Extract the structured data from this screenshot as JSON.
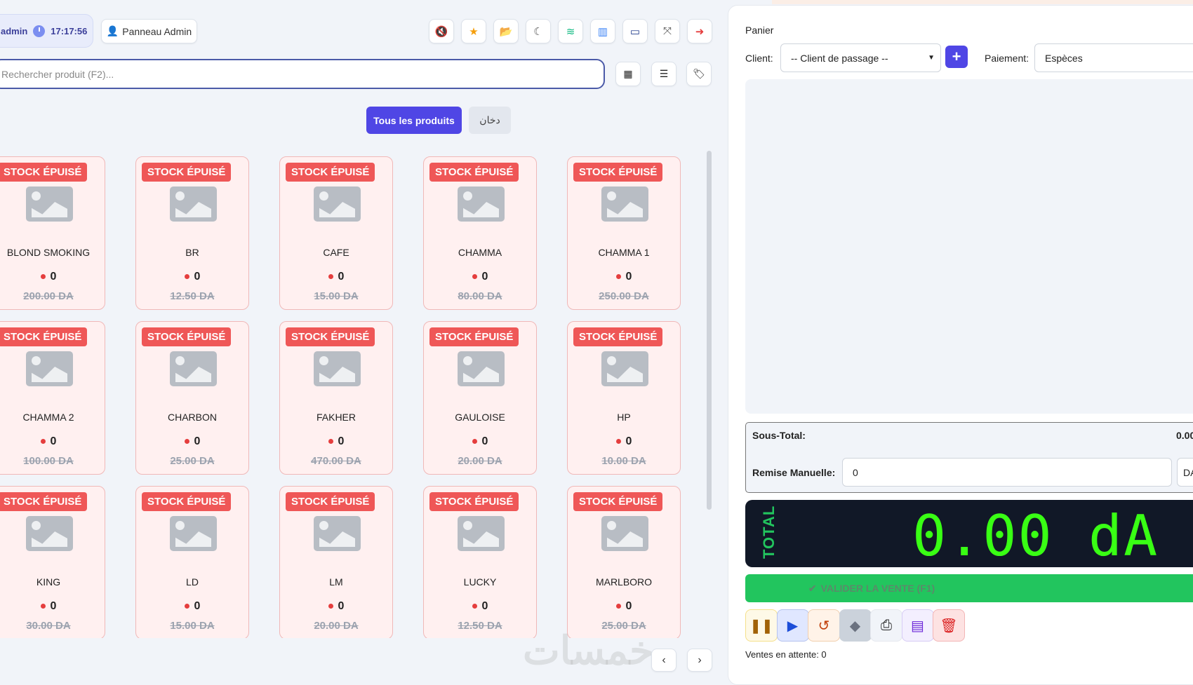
{
  "header": {
    "user": "admin",
    "time": "17:17:56",
    "admin_panel": "Panneau Admin",
    "toolbar": [
      {
        "icon": "mute-icon",
        "color": "#e53e3e"
      },
      {
        "icon": "star-icon",
        "color": "#f59e0b"
      },
      {
        "icon": "folder-icon",
        "color": "#4f46e5"
      },
      {
        "icon": "moon-icon",
        "color": "#555"
      },
      {
        "icon": "database-icon",
        "color": "#10b981"
      },
      {
        "icon": "chart-icon",
        "color": "#3b82f6"
      },
      {
        "icon": "monitor-icon",
        "color": "#1e3a8a"
      },
      {
        "icon": "expand-icon",
        "color": "#555"
      },
      {
        "icon": "logout-icon",
        "color": "#e53e3e"
      }
    ]
  },
  "search": {
    "placeholder": "Rechercher produit (F2)..."
  },
  "categories": [
    "Tous les produits",
    "دخان"
  ],
  "badge": "STOCK ÉPUISÉ",
  "products": [
    {
      "name": "BLOND SMOKING",
      "stock": "0",
      "price": "200.00 DA"
    },
    {
      "name": "BR",
      "stock": "0",
      "price": "12.50 DA"
    },
    {
      "name": "CAFE",
      "stock": "0",
      "price": "15.00 DA"
    },
    {
      "name": "CHAMMA",
      "stock": "0",
      "price": "80.00 DA"
    },
    {
      "name": "CHAMMA 1",
      "stock": "0",
      "price": "250.00 DA"
    },
    {
      "name": "CHAMMA 2",
      "stock": "0",
      "price": "100.00 DA"
    },
    {
      "name": "CHARBON",
      "stock": "0",
      "price": "25.00 DA"
    },
    {
      "name": "FAKHER",
      "stock": "0",
      "price": "470.00 DA"
    },
    {
      "name": "GAULOISE",
      "stock": "0",
      "price": "20.00 DA"
    },
    {
      "name": "HP",
      "stock": "0",
      "price": "10.00 DA"
    },
    {
      "name": "KING",
      "stock": "0",
      "price": "30.00 DA"
    },
    {
      "name": "LD",
      "stock": "0",
      "price": "15.00 DA"
    },
    {
      "name": "LM",
      "stock": "0",
      "price": "20.00 DA"
    },
    {
      "name": "LUCKY",
      "stock": "0",
      "price": "12.50 DA"
    },
    {
      "name": "MARLBORO",
      "stock": "0",
      "price": "25.00 DA"
    }
  ],
  "watermark": "خمسات",
  "cart": {
    "title": "Panier",
    "client_label": "Client:",
    "client_value": "-- Client de passage --",
    "payment_label": "Paiement:",
    "payment_value": "Espèces",
    "subtotal_label": "Sous-Total:",
    "subtotal_value": "0.00",
    "discount_label": "Remise Manuelle:",
    "discount_value": "0",
    "discount_unit": "DA",
    "total_label": "TOTAL",
    "total_value": "0.00 dA",
    "validate": "VALIDER LA VENTE (F1)",
    "pending": "Ventes en attente: 0"
  },
  "actions": [
    {
      "icon": "pause-icon",
      "glyph": "❚❚",
      "color": "#a16207",
      "bg": "#fef9e7",
      "border": "#f5e08a"
    },
    {
      "icon": "play-icon",
      "glyph": "▶",
      "color": "#1d4ed8",
      "bg": "#e0e7ff",
      "border": "#b5c3ee"
    },
    {
      "icon": "undo-icon",
      "glyph": "↺",
      "color": "#c2410c",
      "bg": "#fff3e8",
      "border": "#f1cfae"
    },
    {
      "icon": "diamond-icon",
      "glyph": "◆",
      "color": "#6b7280",
      "bg": "#cbd2db",
      "border": "#cbd2db"
    },
    {
      "icon": "print-icon",
      "glyph": "⎙",
      "color": "#222",
      "bg": "#f1f4f9",
      "border": "#e5e8ee"
    },
    {
      "icon": "document-icon",
      "glyph": "▤",
      "color": "#6d28d9",
      "bg": "#f3effe",
      "border": "#d7ccf5"
    },
    {
      "icon": "trash-icon",
      "glyph": "🗑",
      "color": "#dc2626",
      "bg": "#fde2e2",
      "border": "#f3b5b5"
    }
  ]
}
